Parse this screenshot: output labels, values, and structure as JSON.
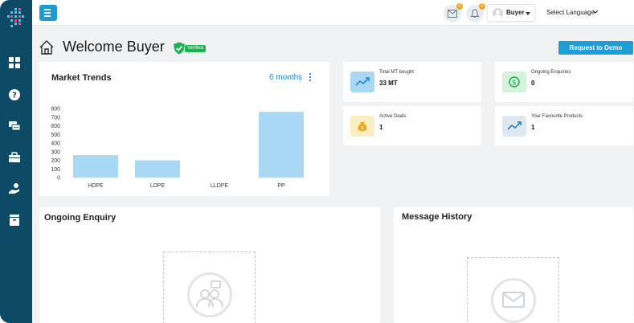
{
  "topbar": {
    "mail_badge": "0",
    "bell_badge": "0",
    "user_label": "Buyer",
    "language_label": "Select Language"
  },
  "header": {
    "title": "Welcome Buyer",
    "verified_label": "Verified",
    "demo_button": "Request to Demo"
  },
  "market_trends": {
    "title": "Market Trends",
    "period": "6 months"
  },
  "stats": [
    {
      "label": "Total MT bought",
      "value": "33 MT",
      "icon": "trend-up-icon"
    },
    {
      "label": "Ongoing Enquiries",
      "value": "0",
      "icon": "dollar-icon"
    },
    {
      "label": "Active Deals",
      "value": "1",
      "icon": "money-bag-icon"
    },
    {
      "label": "Your Favourite Products",
      "value": "1",
      "icon": "trend-up-icon"
    }
  ],
  "ongoing_enquiry": {
    "title": "Ongoing Enquiry"
  },
  "message_history": {
    "title": "Message History"
  },
  "colors": {
    "sidebar": "#0d4a66",
    "accent": "#1e9dd6",
    "bar": "#a9d8f4",
    "verified": "#1eb150"
  },
  "chart_data": {
    "type": "bar",
    "categories": [
      "HDPE",
      "LDPE",
      "LLDPE",
      "PP"
    ],
    "values": [
      260,
      200,
      0,
      760
    ],
    "title": "",
    "xlabel": "",
    "ylabel": "",
    "ylim": [
      0,
      800
    ],
    "yticks": [
      0,
      100,
      200,
      300,
      400,
      500,
      600,
      700,
      800
    ],
    "grid": false
  }
}
